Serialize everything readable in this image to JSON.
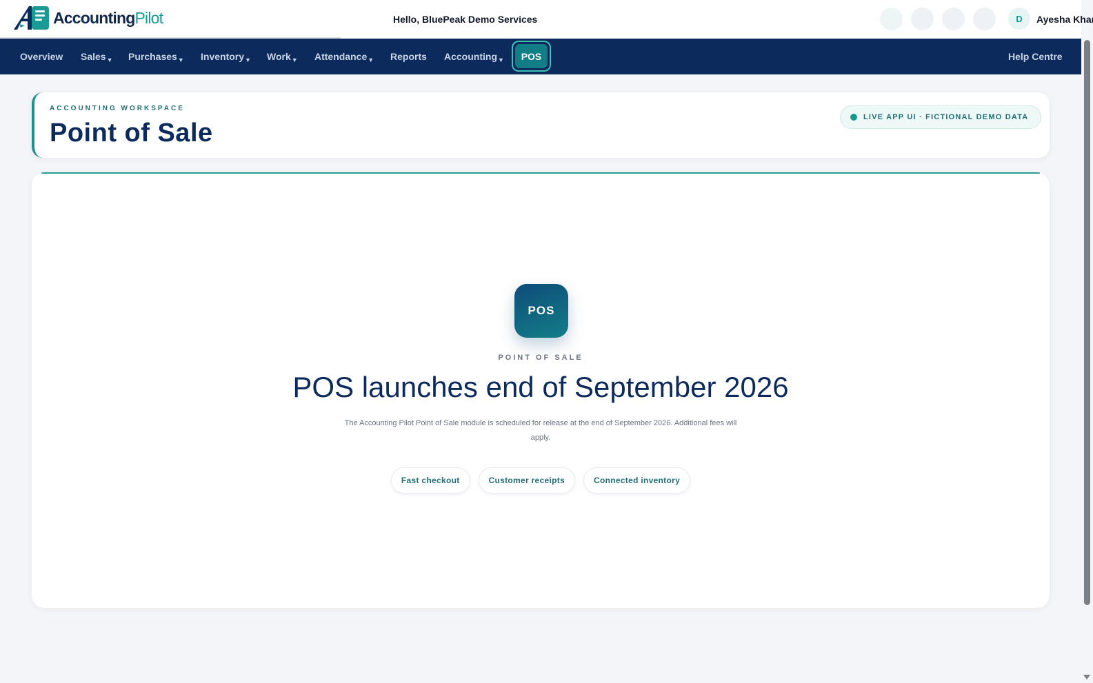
{
  "header": {
    "brand_primary": "Accounting",
    "brand_secondary": "Pilot",
    "greeting": "Hello, BluePeak Demo Services",
    "user_initial": "D",
    "user_name": "Ayesha Khan"
  },
  "nav": {
    "items": [
      {
        "label": "Overview",
        "has_caret": false
      },
      {
        "label": "Sales",
        "has_caret": true
      },
      {
        "label": "Purchases",
        "has_caret": true
      },
      {
        "label": "Inventory",
        "has_caret": true
      },
      {
        "label": "Work",
        "has_caret": true
      },
      {
        "label": "Attendance",
        "has_caret": true
      },
      {
        "label": "Reports",
        "has_caret": false
      },
      {
        "label": "Accounting",
        "has_caret": true
      }
    ],
    "active_label": "POS",
    "help_label": "Help Centre"
  },
  "workspace": {
    "eyebrow": "ACCOUNTING WORKSPACE",
    "title": "Point of Sale",
    "badge": "LIVE APP UI · FICTIONAL DEMO DATA"
  },
  "pos": {
    "icon_label": "POS",
    "eyebrow": "POINT OF SALE",
    "heading": "POS launches end of September 2026",
    "description": "The Accounting Pilot Point of Sale module is scheduled for release at the end of September 2026. Additional fees will apply.",
    "chips": [
      "Fast checkout",
      "Customer receipts",
      "Connected inventory"
    ]
  },
  "colors": {
    "nav_background": "#0c2b5c",
    "accent_teal": "#1a9a94",
    "active_tab": "#117e85"
  }
}
